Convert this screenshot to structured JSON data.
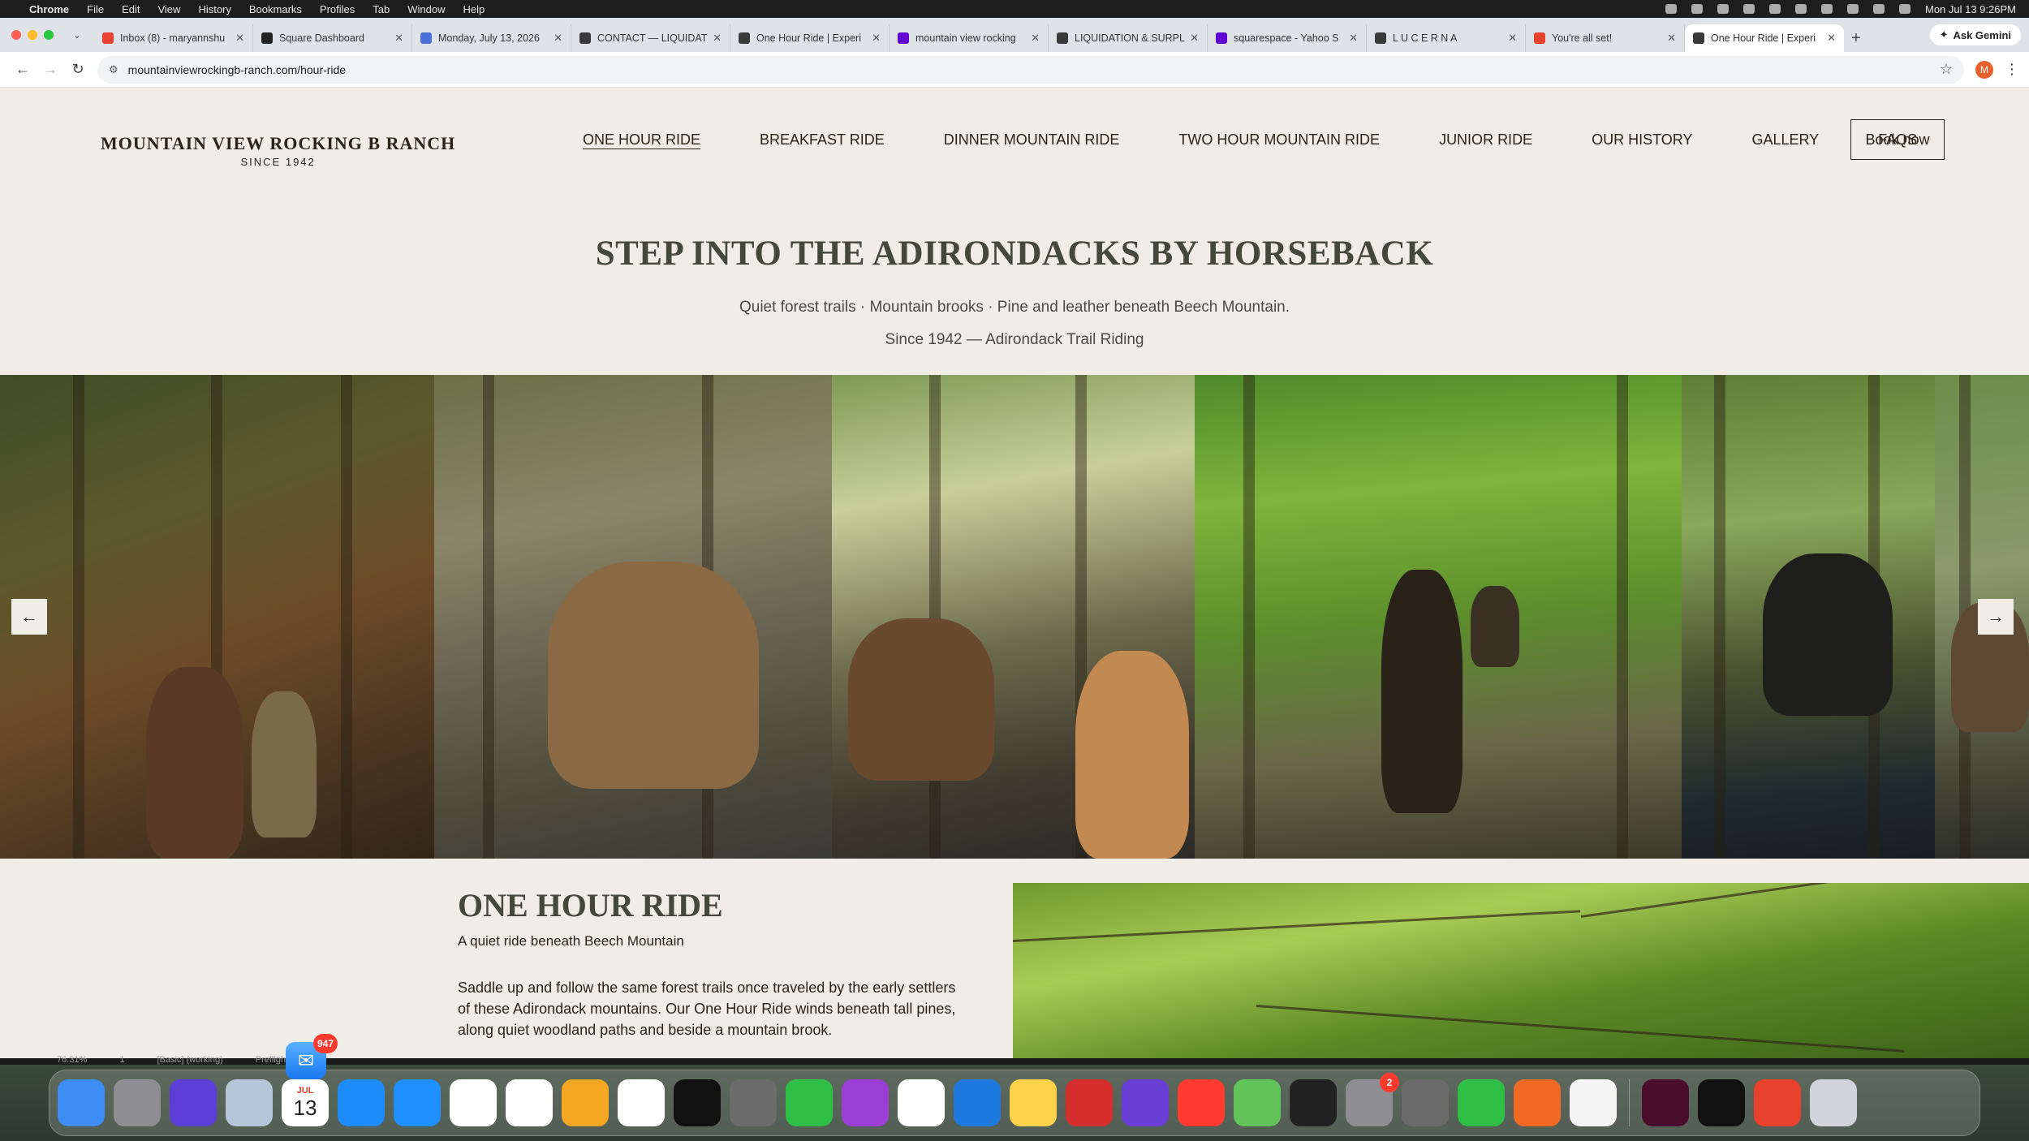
{
  "menubar": {
    "app": "Chrome",
    "items": [
      "File",
      "Edit",
      "View",
      "History",
      "Bookmarks",
      "Profiles",
      "Tab",
      "Window",
      "Help"
    ],
    "datetime": "Mon Jul 13  9:26PM"
  },
  "tabs": [
    {
      "label": "Inbox (8) - maryannshu",
      "color": "#ea4335"
    },
    {
      "label": "Square Dashboard",
      "color": "#222222"
    },
    {
      "label": "Monday, July 13, 2026",
      "color": "#4a6fd8"
    },
    {
      "label": "CONTACT — LIQUIDATI",
      "color": "#3a3a3a"
    },
    {
      "label": "One Hour Ride | Experi",
      "color": "#3a3a3a"
    },
    {
      "label": "mountain view rocking",
      "color": "#6001d2"
    },
    {
      "label": "LIQUIDATION & SURPL",
      "color": "#3a3a3a"
    },
    {
      "label": "squarespace - Yahoo S",
      "color": "#6001d2"
    },
    {
      "label": "L U C E R N A",
      "color": "#3a3a3a"
    },
    {
      "label": "You're all set!",
      "color": "#e8412c"
    },
    {
      "label": "One Hour Ride | Experi",
      "color": "#3a3a3a",
      "active": true
    }
  ],
  "gemini_label": "Ask Gemini",
  "url": "mountainviewrockingb-ranch.com/hour-ride",
  "avatar_letter": "M",
  "site": {
    "logo_name": "MOUNTAIN VIEW ROCKING B RANCH",
    "logo_since": "SINCE 1942",
    "nav": [
      "ONE HOUR RIDE",
      "BREAKFAST RIDE",
      "DINNER MOUNTAIN RIDE",
      "TWO HOUR MOUNTAIN RIDE",
      "JUNIOR RIDE",
      "OUR HISTORY",
      "GALLERY",
      "FAQS"
    ],
    "book_label": "Book now",
    "hero_title": "STEP INTO THE ADIRONDACKS BY HORSEBACK",
    "hero_sub1": "Quiet forest trails · Mountain brooks · Pine and leather beneath Beech Mountain.",
    "hero_sub2": "Since 1942 — Adirondack Trail Riding",
    "prev_arrow": "←",
    "next_arrow": "→",
    "section_title": "ONE HOUR RIDE",
    "section_sub": "A quiet ride beneath Beech Mountain",
    "section_body": "Saddle up and follow the same forest trails once traveled by the early settlers of these Adirondack mountains.  Our One Hour Ride winds beneath tall pines, along quiet woodland paths and beside a mountain brook."
  },
  "app_status": [
    "76.31%",
    "1",
    "[Basic] (working)",
    "Preflight off"
  ],
  "dock": {
    "mail_badge": "947",
    "calendar_month": "JUL",
    "calendar_day": "13",
    "settings_badge": "2",
    "apps": [
      {
        "name": "finder",
        "color": "#3d8df5"
      },
      {
        "name": "launchpad",
        "color": "#8e8e93"
      },
      {
        "name": "siri",
        "color": "#5b3fd6"
      },
      {
        "name": "preview",
        "color": "#b8c4d8"
      },
      {
        "name": "calendar",
        "color": "#ffffff"
      },
      {
        "name": "app-store",
        "color": "#1d8cf8"
      },
      {
        "name": "safari",
        "color": "#1e90ff"
      },
      {
        "name": "chrome",
        "color": "#ffffff"
      },
      {
        "name": "freeform",
        "color": "#ffffff"
      },
      {
        "name": "pages",
        "color": "#f5a623"
      },
      {
        "name": "reminders",
        "color": "#ffffff"
      },
      {
        "name": "apple-tv",
        "color": "#111111"
      },
      {
        "name": "unknown-app",
        "color": "#6b6b6b"
      },
      {
        "name": "numbers",
        "color": "#2fbf46"
      },
      {
        "name": "podcasts",
        "color": "#9b3fd6"
      },
      {
        "name": "photos",
        "color": "#ffffff"
      },
      {
        "name": "keynote",
        "color": "#1f7ae0"
      },
      {
        "name": "notes",
        "color": "#fbd24a"
      },
      {
        "name": "photo-booth",
        "color": "#d62d2d"
      },
      {
        "name": "imovie",
        "color": "#6a3fd6"
      },
      {
        "name": "news",
        "color": "#ff3b30"
      },
      {
        "name": "maps",
        "color": "#62c35a"
      },
      {
        "name": "activity-monitor",
        "color": "#222222"
      },
      {
        "name": "system-settings",
        "color": "#8e8e93"
      },
      {
        "name": "unknown-app-2",
        "color": "#6b6b6b"
      },
      {
        "name": "facetime",
        "color": "#2fbf46"
      },
      {
        "name": "garageband",
        "color": "#f06a24"
      },
      {
        "name": "textedit",
        "color": "#f4f4f4"
      },
      {
        "name": "indesign",
        "color": "#4a0d2e"
      },
      {
        "name": "spotify",
        "color": "#111111"
      },
      {
        "name": "creative-cloud",
        "color": "#e8412c"
      },
      {
        "name": "trash",
        "color": "#cfd4da"
      }
    ]
  }
}
